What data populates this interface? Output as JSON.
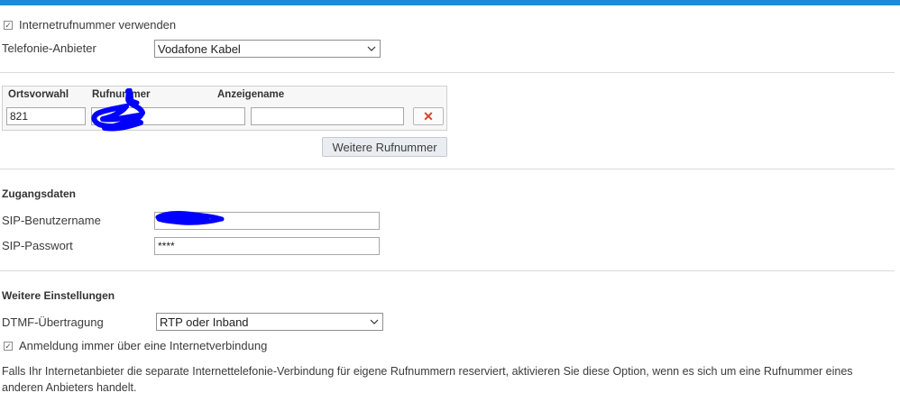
{
  "internet_number": {
    "checkbox_label": "Internetrufnummer verwenden",
    "checked": true
  },
  "provider": {
    "label": "Telefonie-Anbieter",
    "selected": "Vodafone Kabel"
  },
  "phone_numbers": {
    "columns": {
      "area_code": "Ortsvorwahl",
      "number": "Rufnummer",
      "display_name": "Anzeigename"
    },
    "rows": [
      {
        "area_code": "821",
        "number": "",
        "display_name": ""
      }
    ],
    "delete_icon": "close-icon",
    "add_button_label": "Weitere Rufnummer"
  },
  "credentials": {
    "heading": "Zugangsdaten",
    "username_label": "SIP-Benutzername",
    "username_value": "",
    "password_label": "SIP-Passwort",
    "password_value": "****"
  },
  "more_settings": {
    "heading": "Weitere Einstellungen",
    "dtmf_label": "DTMF-Übertragung",
    "dtmf_selected": "RTP oder Inband",
    "always_internet_label": "Anmeldung immer über eine Internetverbindung",
    "always_internet_checked": true,
    "description": "Falls Ihr Internetanbieter die separate Internettelefonie-Verbindung für eigene Rufnummern reserviert, aktivieren Sie diese Option, wenn es sich um eine Rufnummer eines anderen Anbieters handelt."
  },
  "colors": {
    "accent_bar": "#1f8ad6",
    "delete_red": "#d9412b",
    "redaction_blue": "#0000ff"
  }
}
